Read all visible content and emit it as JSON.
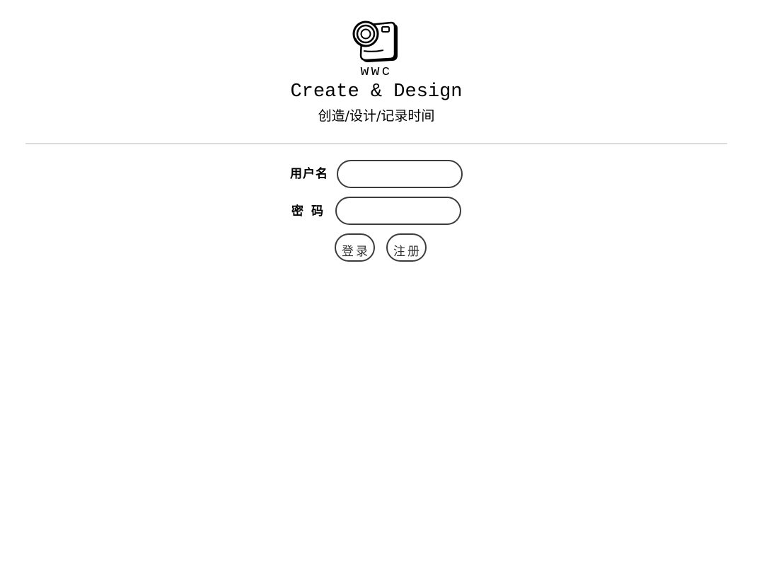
{
  "header": {
    "logo_icon": "camera-icon",
    "brand": "wwc",
    "slogan_en": "Create & Design",
    "slogan_cn": "创造/设计/记录时间"
  },
  "form": {
    "username_label": "用户名",
    "username_value": "",
    "password_label": "密码",
    "password_value": "",
    "login_label": "登录",
    "register_label": "注册"
  },
  "colors": {
    "text": "#000000",
    "border": "#3c3c3c",
    "divider": "#dcdcdc",
    "background": "#ffffff"
  }
}
